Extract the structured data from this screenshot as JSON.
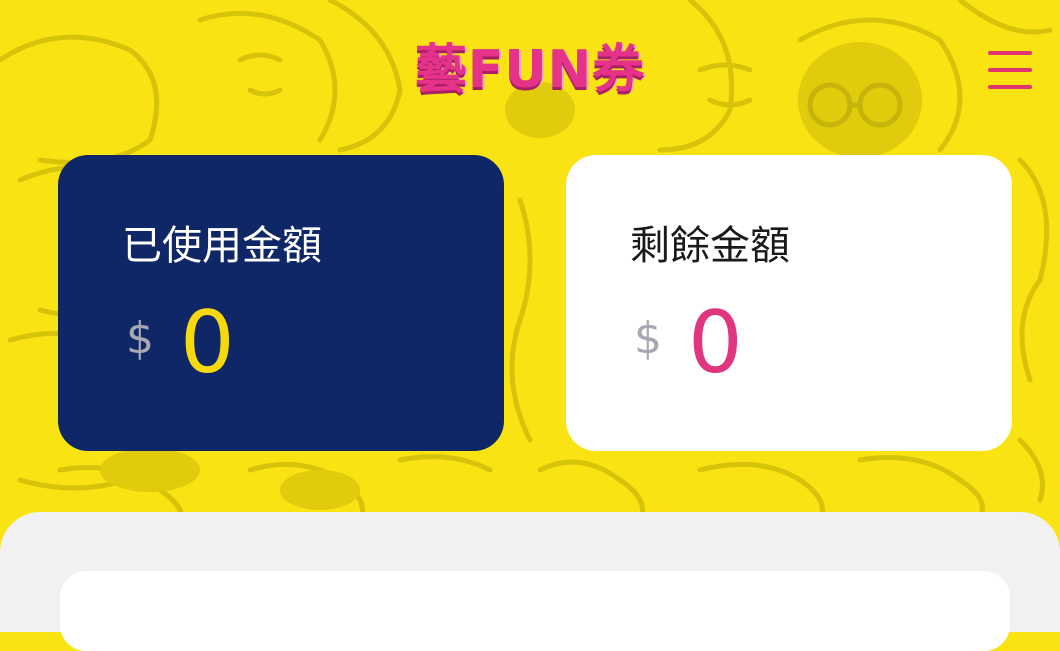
{
  "header": {
    "logo_text": "藝FUN券",
    "menu_icon": "hamburger-menu-icon"
  },
  "balance": {
    "used": {
      "label": "已使用金額",
      "currency": "$",
      "amount": "0"
    },
    "remaining": {
      "label": "剩餘金額",
      "currency": "$",
      "amount": "0"
    }
  },
  "colors": {
    "background": "#f9e312",
    "used_card": "#0f2766",
    "used_amount": "#f5d90c",
    "remaining_card": "#ffffff",
    "remaining_amount": "#e0357f",
    "brand_pink": "#e6338a",
    "panel": "#f1f1f1"
  }
}
